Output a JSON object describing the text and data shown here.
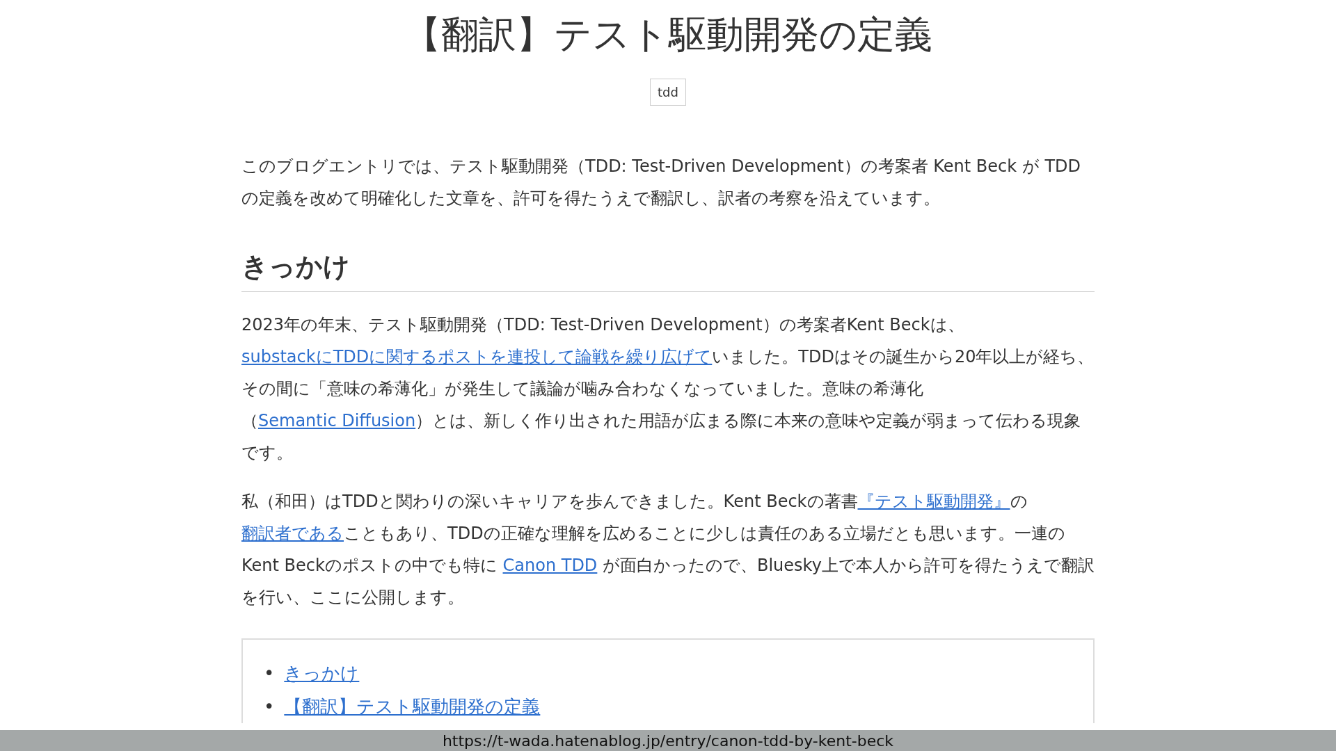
{
  "article": {
    "title": "【翻訳】テスト駆動開発の定義",
    "tags": [
      "tdd"
    ],
    "intro": [
      {
        "text": "このブログエントリでは、テスト駆動開発（TDD: Test-Driven Development）の考案者 Kent Beck が TDD の定義を改めて明確化した文章を、許可を得たうえで翻訳し、訳者の考察を沿えています。",
        "link": false
      }
    ],
    "section_heading": "きっかけ",
    "paragraphs": [
      [
        {
          "text": "2023年の年末、テスト駆動開発（TDD: Test-Driven Development）の考案者Kent Beckは、",
          "link": false
        },
        {
          "text": "substackにTDDに関するポストを連投して論戦を繰り広げて",
          "link": true
        },
        {
          "text": "いました。TDDはその誕生から20年以上が経ち、その間に「意味の希薄化」が発生して議論が噛み合わなくなっていました。意味の希薄化（",
          "link": false
        },
        {
          "text": "Semantic Diffusion",
          "link": true
        },
        {
          "text": "）とは、新しく作り出された用語が広まる際に本来の意味や定義が弱まって伝わる現象です。",
          "link": false
        }
      ],
      [
        {
          "text": "私（和田）はTDDと関わりの深いキャリアを歩んできました。Kent Beckの著書",
          "link": false
        },
        {
          "text": "『テスト駆動開発』",
          "link": true
        },
        {
          "text": "の",
          "link": false
        },
        {
          "text": "翻訳者である",
          "link": true
        },
        {
          "text": "こともあり、TDDの正確な理解を広めることに少しは責任のある立場だとも思います。一連のKent Beckのポストの中でも特に ",
          "link": false
        },
        {
          "text": "Canon TDD",
          "link": true
        },
        {
          "text": " が面白かったので、Bluesky上で本人から許可を得たうえで翻訳を行い、ここに公開します。",
          "link": false
        }
      ]
    ],
    "toc": [
      {
        "marker": "•",
        "label": "きっかけ"
      },
      {
        "marker": "•",
        "label": "【翻訳】テスト駆動開発の定義"
      }
    ]
  },
  "url_bar": "https://t-wada.hatenablog.jp/entry/canon-tdd-by-kent-beck"
}
